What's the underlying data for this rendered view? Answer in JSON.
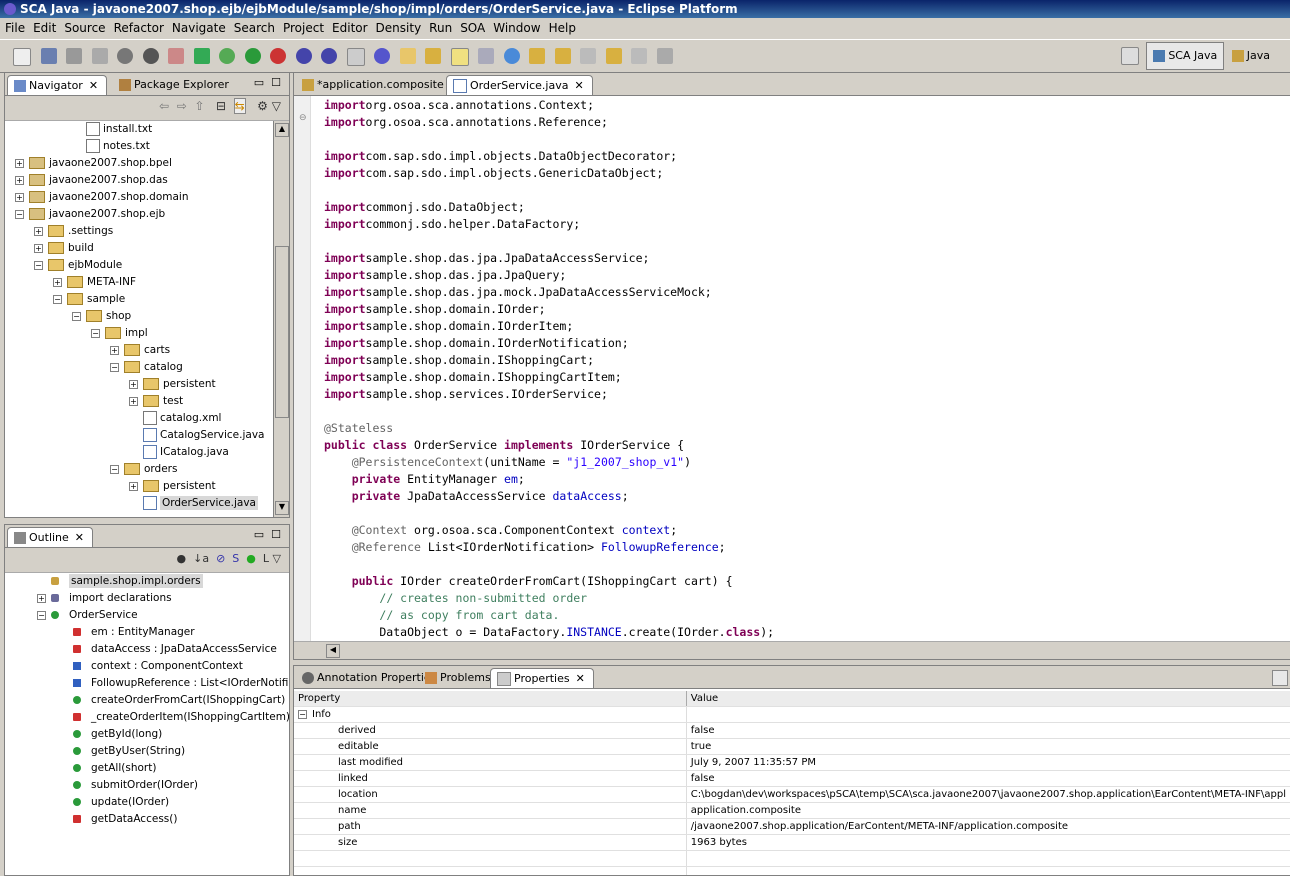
{
  "window": {
    "title": "SCA Java - javaone2007.shop.ejb/ejbModule/sample/shop/impl/orders/OrderService.java - Eclipse Platform"
  },
  "menu": [
    "File",
    "Edit",
    "Source",
    "Refactor",
    "Navigate",
    "Search",
    "Project",
    "Editor",
    "Density",
    "Run",
    "SOA",
    "Window",
    "Help"
  ],
  "perspectives": {
    "active": "SCA Java",
    "other": "Java"
  },
  "navigator": {
    "tabs": [
      "Navigator",
      "Package Explorer"
    ],
    "items": [
      {
        "label": "install.txt",
        "indent": 3,
        "type": "file"
      },
      {
        "label": "notes.txt",
        "indent": 3,
        "type": "file"
      },
      {
        "label": "javaone2007.shop.bpel",
        "indent": 0,
        "type": "project",
        "exp": "+"
      },
      {
        "label": "javaone2007.shop.das",
        "indent": 0,
        "type": "project",
        "exp": "+"
      },
      {
        "label": "javaone2007.shop.domain",
        "indent": 0,
        "type": "project",
        "exp": "+"
      },
      {
        "label": "javaone2007.shop.ejb",
        "indent": 0,
        "type": "project",
        "exp": "-"
      },
      {
        "label": ".settings",
        "indent": 1,
        "type": "folder",
        "exp": "+"
      },
      {
        "label": "build",
        "indent": 1,
        "type": "folder",
        "exp": "+"
      },
      {
        "label": "ejbModule",
        "indent": 1,
        "type": "folder",
        "exp": "-"
      },
      {
        "label": "META-INF",
        "indent": 2,
        "type": "folder",
        "exp": "+"
      },
      {
        "label": "sample",
        "indent": 2,
        "type": "folder",
        "exp": "-"
      },
      {
        "label": "shop",
        "indent": 3,
        "type": "folder",
        "exp": "-"
      },
      {
        "label": "impl",
        "indent": 4,
        "type": "folder",
        "exp": "-"
      },
      {
        "label": "carts",
        "indent": 5,
        "type": "folder",
        "exp": "+"
      },
      {
        "label": "catalog",
        "indent": 5,
        "type": "folder",
        "exp": "-"
      },
      {
        "label": "persistent",
        "indent": 6,
        "type": "folder",
        "exp": "+"
      },
      {
        "label": "test",
        "indent": 6,
        "type": "folder",
        "exp": "+"
      },
      {
        "label": "catalog.xml",
        "indent": 6,
        "type": "xml"
      },
      {
        "label": "CatalogService.java",
        "indent": 6,
        "type": "java"
      },
      {
        "label": "ICatalog.java",
        "indent": 6,
        "type": "java"
      },
      {
        "label": "orders",
        "indent": 5,
        "type": "folder",
        "exp": "-"
      },
      {
        "label": "persistent",
        "indent": 6,
        "type": "folder",
        "exp": "+"
      },
      {
        "label": "OrderService.java",
        "indent": 6,
        "type": "java",
        "selected": true
      }
    ]
  },
  "outline": {
    "tab": "Outline",
    "items": [
      {
        "label": "sample.shop.impl.orders",
        "indent": 1,
        "icon": "pkg",
        "selected": true
      },
      {
        "label": "import declarations",
        "indent": 1,
        "icon": "imp",
        "exp": "+"
      },
      {
        "label": "OrderService",
        "indent": 1,
        "icon": "class",
        "exp": "-"
      },
      {
        "label": "em : EntityManager",
        "indent": 2,
        "icon": "priv-field"
      },
      {
        "label": "dataAccess : JpaDataAccessService",
        "indent": 2,
        "icon": "priv-field"
      },
      {
        "label": "context : ComponentContext",
        "indent": 2,
        "icon": "tri"
      },
      {
        "label": "FollowupReference : List<IOrderNotification>",
        "indent": 2,
        "icon": "tri"
      },
      {
        "label": "createOrderFromCart(IShoppingCart)",
        "indent": 2,
        "icon": "pub"
      },
      {
        "label": "_createOrderItem(IShoppingCartItem)",
        "indent": 2,
        "icon": "priv"
      },
      {
        "label": "getById(long)",
        "indent": 2,
        "icon": "pub"
      },
      {
        "label": "getByUser(String)",
        "indent": 2,
        "icon": "pub"
      },
      {
        "label": "getAll(short)",
        "indent": 2,
        "icon": "pub"
      },
      {
        "label": "submitOrder(IOrder)",
        "indent": 2,
        "icon": "pub"
      },
      {
        "label": "update(IOrder)",
        "indent": 2,
        "icon": "pub"
      },
      {
        "label": "getDataAccess()",
        "indent": 2,
        "icon": "priv"
      }
    ]
  },
  "editor": {
    "tabs": [
      "*application.composite",
      "OrderService.java"
    ],
    "lines": [
      [
        [
          "kw",
          "import"
        ],
        [
          "",
          "org.osoa.sca.annotations.Context;"
        ]
      ],
      [
        [
          "kw",
          "import"
        ],
        [
          "",
          "org.osoa.sca.annotations.Reference;"
        ]
      ],
      [],
      [
        [
          "kw",
          "import"
        ],
        [
          "",
          "com.sap.sdo.impl.objects.DataObjectDecorator;"
        ]
      ],
      [
        [
          "kw",
          "import"
        ],
        [
          "",
          "com.sap.sdo.impl.objects.GenericDataObject;"
        ]
      ],
      [],
      [
        [
          "kw",
          "import"
        ],
        [
          "",
          "commonj.sdo.DataObject;"
        ]
      ],
      [
        [
          "kw",
          "import"
        ],
        [
          "",
          "commonj.sdo.helper.DataFactory;"
        ]
      ],
      [],
      [
        [
          "kw",
          "import"
        ],
        [
          "",
          "sample.shop.das.jpa.JpaDataAccessService;"
        ]
      ],
      [
        [
          "kw",
          "import"
        ],
        [
          "",
          "sample.shop.das.jpa.JpaQuery;"
        ]
      ],
      [
        [
          "kw",
          "import"
        ],
        [
          "",
          "sample.shop.das.jpa.mock.JpaDataAccessServiceMock;"
        ]
      ],
      [
        [
          "kw",
          "import"
        ],
        [
          "",
          "sample.shop.domain.IOrder;"
        ]
      ],
      [
        [
          "kw",
          "import"
        ],
        [
          "",
          "sample.shop.domain.IOrderItem;"
        ]
      ],
      [
        [
          "kw",
          "import"
        ],
        [
          "",
          "sample.shop.domain.IOrderNotification;"
        ]
      ],
      [
        [
          "kw",
          "import"
        ],
        [
          "",
          "sample.shop.domain.IShoppingCart;"
        ]
      ],
      [
        [
          "kw",
          "import"
        ],
        [
          "",
          "sample.shop.domain.IShoppingCartItem;"
        ]
      ],
      [
        [
          "kw",
          "import"
        ],
        [
          "",
          "sample.shop.services.IOrderService;"
        ]
      ],
      [],
      [
        [
          "ann",
          "@Stateless"
        ]
      ],
      [
        [
          "kw",
          "public class"
        ],
        [
          "",
          " OrderService "
        ],
        [
          "kw",
          "implements"
        ],
        [
          "",
          " IOrderService {"
        ]
      ],
      [
        [
          "",
          "    "
        ],
        [
          "ann",
          "@PersistenceContext"
        ],
        [
          "",
          "(unitName = "
        ],
        [
          "str",
          "\"j1_2007_shop_v1\""
        ],
        [
          "",
          ")"
        ]
      ],
      [
        [
          "",
          "    "
        ],
        [
          "kw",
          "private"
        ],
        [
          "",
          " EntityManager "
        ],
        [
          "fld",
          "em"
        ],
        [
          "",
          ";"
        ]
      ],
      [
        [
          "",
          "    "
        ],
        [
          "kw",
          "private"
        ],
        [
          "",
          " JpaDataAccessService "
        ],
        [
          "fld",
          "dataAccess"
        ],
        [
          "",
          ";"
        ]
      ],
      [],
      [
        [
          "",
          "    "
        ],
        [
          "ann",
          "@Context"
        ],
        [
          "",
          " org.osoa.sca.ComponentContext "
        ],
        [
          "fld",
          "context"
        ],
        [
          "",
          ";"
        ]
      ],
      [
        [
          "",
          "    "
        ],
        [
          "ann",
          "@Reference"
        ],
        [
          "",
          " List<IOrderNotification> "
        ],
        [
          "fld",
          "FollowupReference"
        ],
        [
          "",
          ";"
        ]
      ],
      [],
      [
        [
          "",
          "    "
        ],
        [
          "kw",
          "public"
        ],
        [
          "",
          " IOrder createOrderFromCart(IShoppingCart cart) {"
        ]
      ],
      [
        [
          "",
          "        "
        ],
        [
          "cmt",
          "// creates non-submitted order"
        ]
      ],
      [
        [
          "",
          "        "
        ],
        [
          "cmt",
          "// as copy from cart data."
        ]
      ],
      [
        [
          "",
          "        DataObject o = DataFactory."
        ],
        [
          "fld",
          "INSTANCE"
        ],
        [
          "",
          ".create(IOrder."
        ],
        [
          "kw",
          "class"
        ],
        [
          "",
          ");"
        ]
      ]
    ]
  },
  "bottom": {
    "tabs": [
      "Annotation Properties",
      "Problems",
      "Properties"
    ],
    "headers": [
      "Property",
      "Value"
    ],
    "group": "Info",
    "rows": [
      [
        "derived",
        "false"
      ],
      [
        "editable",
        "true"
      ],
      [
        "last modified",
        "July 9, 2007 11:35:57 PM"
      ],
      [
        "linked",
        "false"
      ],
      [
        "location",
        "C:\\bogdan\\dev\\workspaces\\pSCA\\temp\\SCA\\sca.javaone2007\\javaone2007.shop.application\\EarContent\\META-INF\\appl"
      ],
      [
        "name",
        "application.composite"
      ],
      [
        "path",
        "/javaone2007.shop.application/EarContent/META-INF/application.composite"
      ],
      [
        "size",
        "1963  bytes"
      ]
    ]
  },
  "colors": {
    "keyword": "#7f0055",
    "annotation": "#646464",
    "string": "#2a00ff",
    "comment": "#3f7f5f",
    "field": "#0000c0"
  }
}
